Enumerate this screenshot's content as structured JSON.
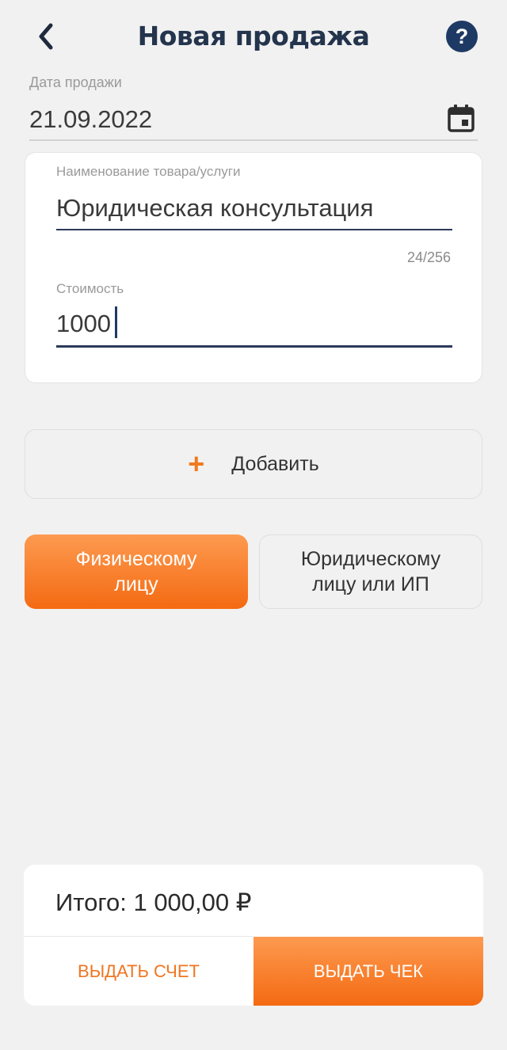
{
  "header": {
    "title": "Новая продажа",
    "back_icon": "chevron-left-icon",
    "help_label": "?"
  },
  "date": {
    "label": "Дата продажи",
    "value": "21.09.2022",
    "icon": "calendar-icon"
  },
  "item": {
    "name_label": "Наименование товара/услуги",
    "name_value": "Юридическая консультация",
    "char_counter": "24/256",
    "price_label": "Стоимость",
    "price_value": "1000"
  },
  "add_button": {
    "icon": "+",
    "label": "Добавить"
  },
  "buyer_type": {
    "individual_label": "Физическому\nлицу",
    "legal_label": "Юридическому\nлицу или ИП",
    "selected": "individual"
  },
  "summary": {
    "total_text": "Итого: 1 000,00 ₽",
    "invoice_label": "ВЫДАТЬ СЧЕТ",
    "receipt_label": "ВЫДАТЬ ЧЕК"
  },
  "colors": {
    "accent": "#f46a12",
    "accent_light": "#fd9a50",
    "primary_dark": "#1e3a64",
    "background": "#f1f1f1"
  }
}
